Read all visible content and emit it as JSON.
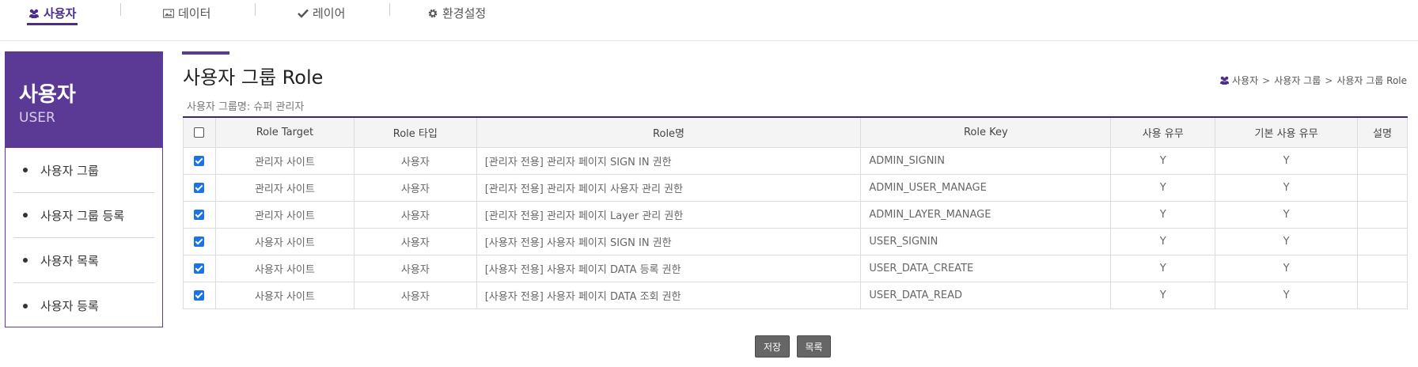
{
  "topnav": {
    "items": [
      {
        "label": "사용자",
        "icon": "users-icon",
        "active": true
      },
      {
        "label": "데이터",
        "icon": "image-icon",
        "active": false
      },
      {
        "label": "레이어",
        "icon": "check-icon",
        "active": false
      },
      {
        "label": "환경설정",
        "icon": "gear-icon",
        "active": false
      }
    ]
  },
  "sidebar": {
    "title": "사용자",
    "subtitle": "USER",
    "items": [
      {
        "label": "사용자 그룹"
      },
      {
        "label": "사용자 그룹 등록"
      },
      {
        "label": "사용자 목록"
      },
      {
        "label": "사용자 등록"
      }
    ]
  },
  "page": {
    "title": "사용자 그룹 Role",
    "subtitle": "사용자 그룹명: 슈퍼 관리자",
    "breadcrumb": [
      "사용자",
      "사용자 그룹",
      "사용자 그룹 Role"
    ]
  },
  "table": {
    "columns": [
      "Role Target",
      "Role 타입",
      "Role명",
      "Role Key",
      "사용 유무",
      "기본 사용 유무",
      "설명"
    ],
    "rows": [
      {
        "checked": true,
        "target": "관리자 사이트",
        "type": "사용자",
        "name": "[관리자 전용] 관리자 페이지 SIGN IN 권한",
        "key": "ADMIN_SIGNIN",
        "use": "Y",
        "default_use": "Y",
        "desc": ""
      },
      {
        "checked": true,
        "target": "관리자 사이트",
        "type": "사용자",
        "name": "[관리자 전용] 관리자 페이지 사용자 관리 권한",
        "key": "ADMIN_USER_MANAGE",
        "use": "Y",
        "default_use": "Y",
        "desc": ""
      },
      {
        "checked": true,
        "target": "관리자 사이트",
        "type": "사용자",
        "name": "[관리자 전용] 관리자 페이지 Layer 관리 권한",
        "key": "ADMIN_LAYER_MANAGE",
        "use": "Y",
        "default_use": "Y",
        "desc": ""
      },
      {
        "checked": true,
        "target": "사용자 사이트",
        "type": "사용자",
        "name": "[사용자 전용] 사용자 페이지 SIGN IN 권한",
        "key": "USER_SIGNIN",
        "use": "Y",
        "default_use": "Y",
        "desc": ""
      },
      {
        "checked": true,
        "target": "사용자 사이트",
        "type": "사용자",
        "name": "[사용자 전용] 사용자 페이지 DATA 등록 권한",
        "key": "USER_DATA_CREATE",
        "use": "Y",
        "default_use": "Y",
        "desc": ""
      },
      {
        "checked": true,
        "target": "사용자 사이트",
        "type": "사용자",
        "name": "[사용자 전용] 사용자 페이지 DATA 조회 권한",
        "key": "USER_DATA_READ",
        "use": "Y",
        "default_use": "Y",
        "desc": ""
      }
    ]
  },
  "buttons": {
    "save_label": "저장",
    "list_label": "목록"
  },
  "colors": {
    "accent": "#5b3a96",
    "checkbox": "#1a73e8",
    "button": "#666666"
  }
}
